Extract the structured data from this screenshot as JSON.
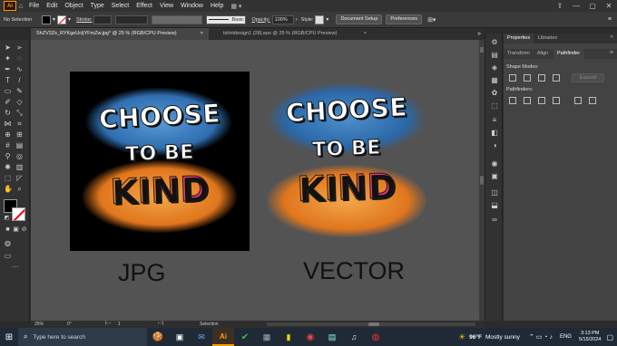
{
  "menu": {
    "items": [
      "File",
      "Edit",
      "Object",
      "Type",
      "Select",
      "Effect",
      "View",
      "Window",
      "Help"
    ],
    "app_logo": "Ai"
  },
  "control": {
    "selection": "No Selection",
    "stroke_label": "Stroke:",
    "brush_name": "Basic",
    "opacity_label": "Opacity:",
    "opacity_value": "100%",
    "style_label": "Style:",
    "doc_setup": "Document Setup",
    "preferences": "Preferences"
  },
  "tabs": [
    {
      "label": "ShZV3Zs_RYKgeUcljYFmZw.jpg* @ 25 % (RGB/CPU Preview)",
      "close": "×"
    },
    {
      "label": "tshirtdesign1 (28).eps @ 25 % (RGB/CPU Preview)",
      "close": "×"
    }
  ],
  "canvas": {
    "jpg_caption": "JPG",
    "vector_caption": "VECTOR",
    "art_line1": "CHOOSE",
    "art_line2": "TO BE",
    "art_line3": "KIND"
  },
  "panel": {
    "tabs": [
      "Properties",
      "Libraries"
    ],
    "subtabs": [
      "Transform",
      "Align",
      "Pathfinder"
    ],
    "shape_modes": "Shape Modes:",
    "expand": "Expand",
    "pathfinders": "Pathfinders:"
  },
  "status": {
    "zoom": "25%",
    "rotation": "0°",
    "artboard": "1",
    "tool": "Selection"
  },
  "taskbar": {
    "search_placeholder": "Type here to search",
    "weather_temp": "96°F",
    "weather_desc": "Mostly sunny",
    "lang": "ENG",
    "time": "3:13 PM",
    "date": "5/15/2024"
  },
  "colors": {
    "accent_orange": "#ff9a00",
    "kind_orange": "#f07a1d",
    "kind_pink": "#e0357a",
    "splash_blue": "#3a86c8",
    "splash_orange": "#f08a2a"
  }
}
